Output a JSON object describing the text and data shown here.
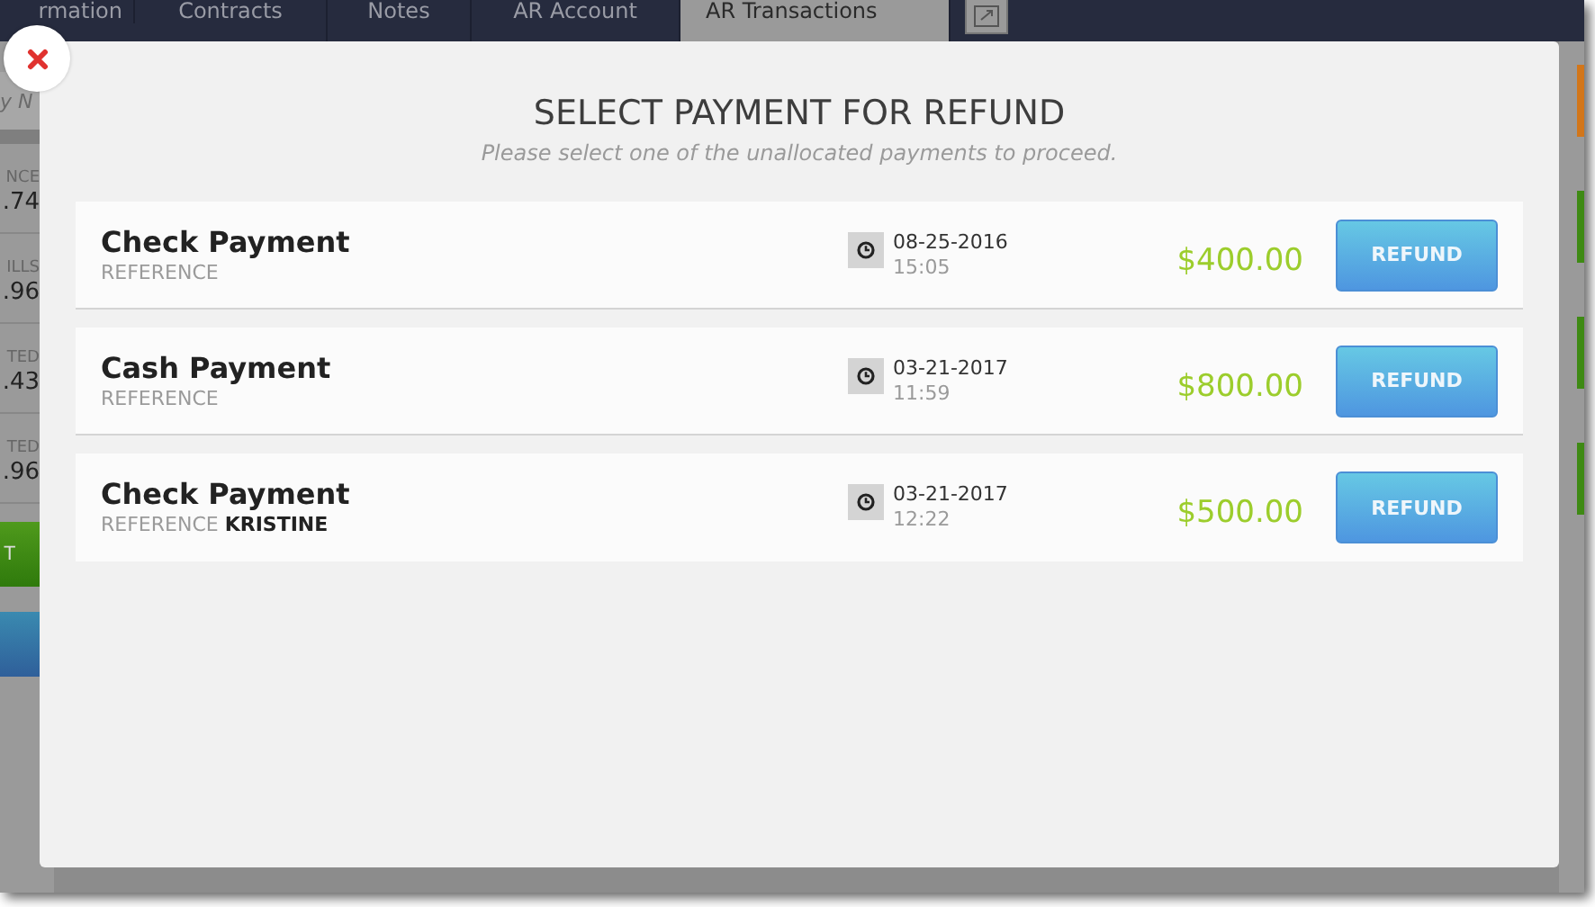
{
  "tabs": [
    {
      "label": "rmation",
      "selected": false
    },
    {
      "label": "Contracts",
      "selected": false
    },
    {
      "label": "Notes",
      "selected": false
    },
    {
      "label": "AR Account",
      "selected": false
    },
    {
      "label": "AR Transactions",
      "selected": true
    }
  ],
  "left_panel": {
    "search_placeholder": "y N",
    "stats": [
      {
        "label": "NCE",
        "value": ".74"
      },
      {
        "label": "ILLS",
        "value": ".96"
      },
      {
        "label": "TED",
        "value": ".43"
      },
      {
        "label": "TED",
        "value": ".96"
      }
    ],
    "action_button": "T"
  },
  "modal": {
    "title": "SELECT PAYMENT FOR REFUND",
    "subtitle": "Please select one of the unallocated payments to proceed.",
    "payments": [
      {
        "type": "Check Payment",
        "reference": "REFERENCE",
        "date": "08-25-2016",
        "time": "15:05",
        "amount": "$400.00",
        "button": "REFUND"
      },
      {
        "type": "Cash Payment",
        "reference": "REFERENCE",
        "date": "03-21-2017",
        "time": "11:59",
        "amount": "$800.00",
        "button": "REFUND"
      },
      {
        "type": "Check Payment",
        "reference": "REFERENCE **KRISTINE**",
        "date": "03-21-2017",
        "time": "12:22",
        "amount": "$500.00",
        "button": "REFUND"
      }
    ]
  }
}
